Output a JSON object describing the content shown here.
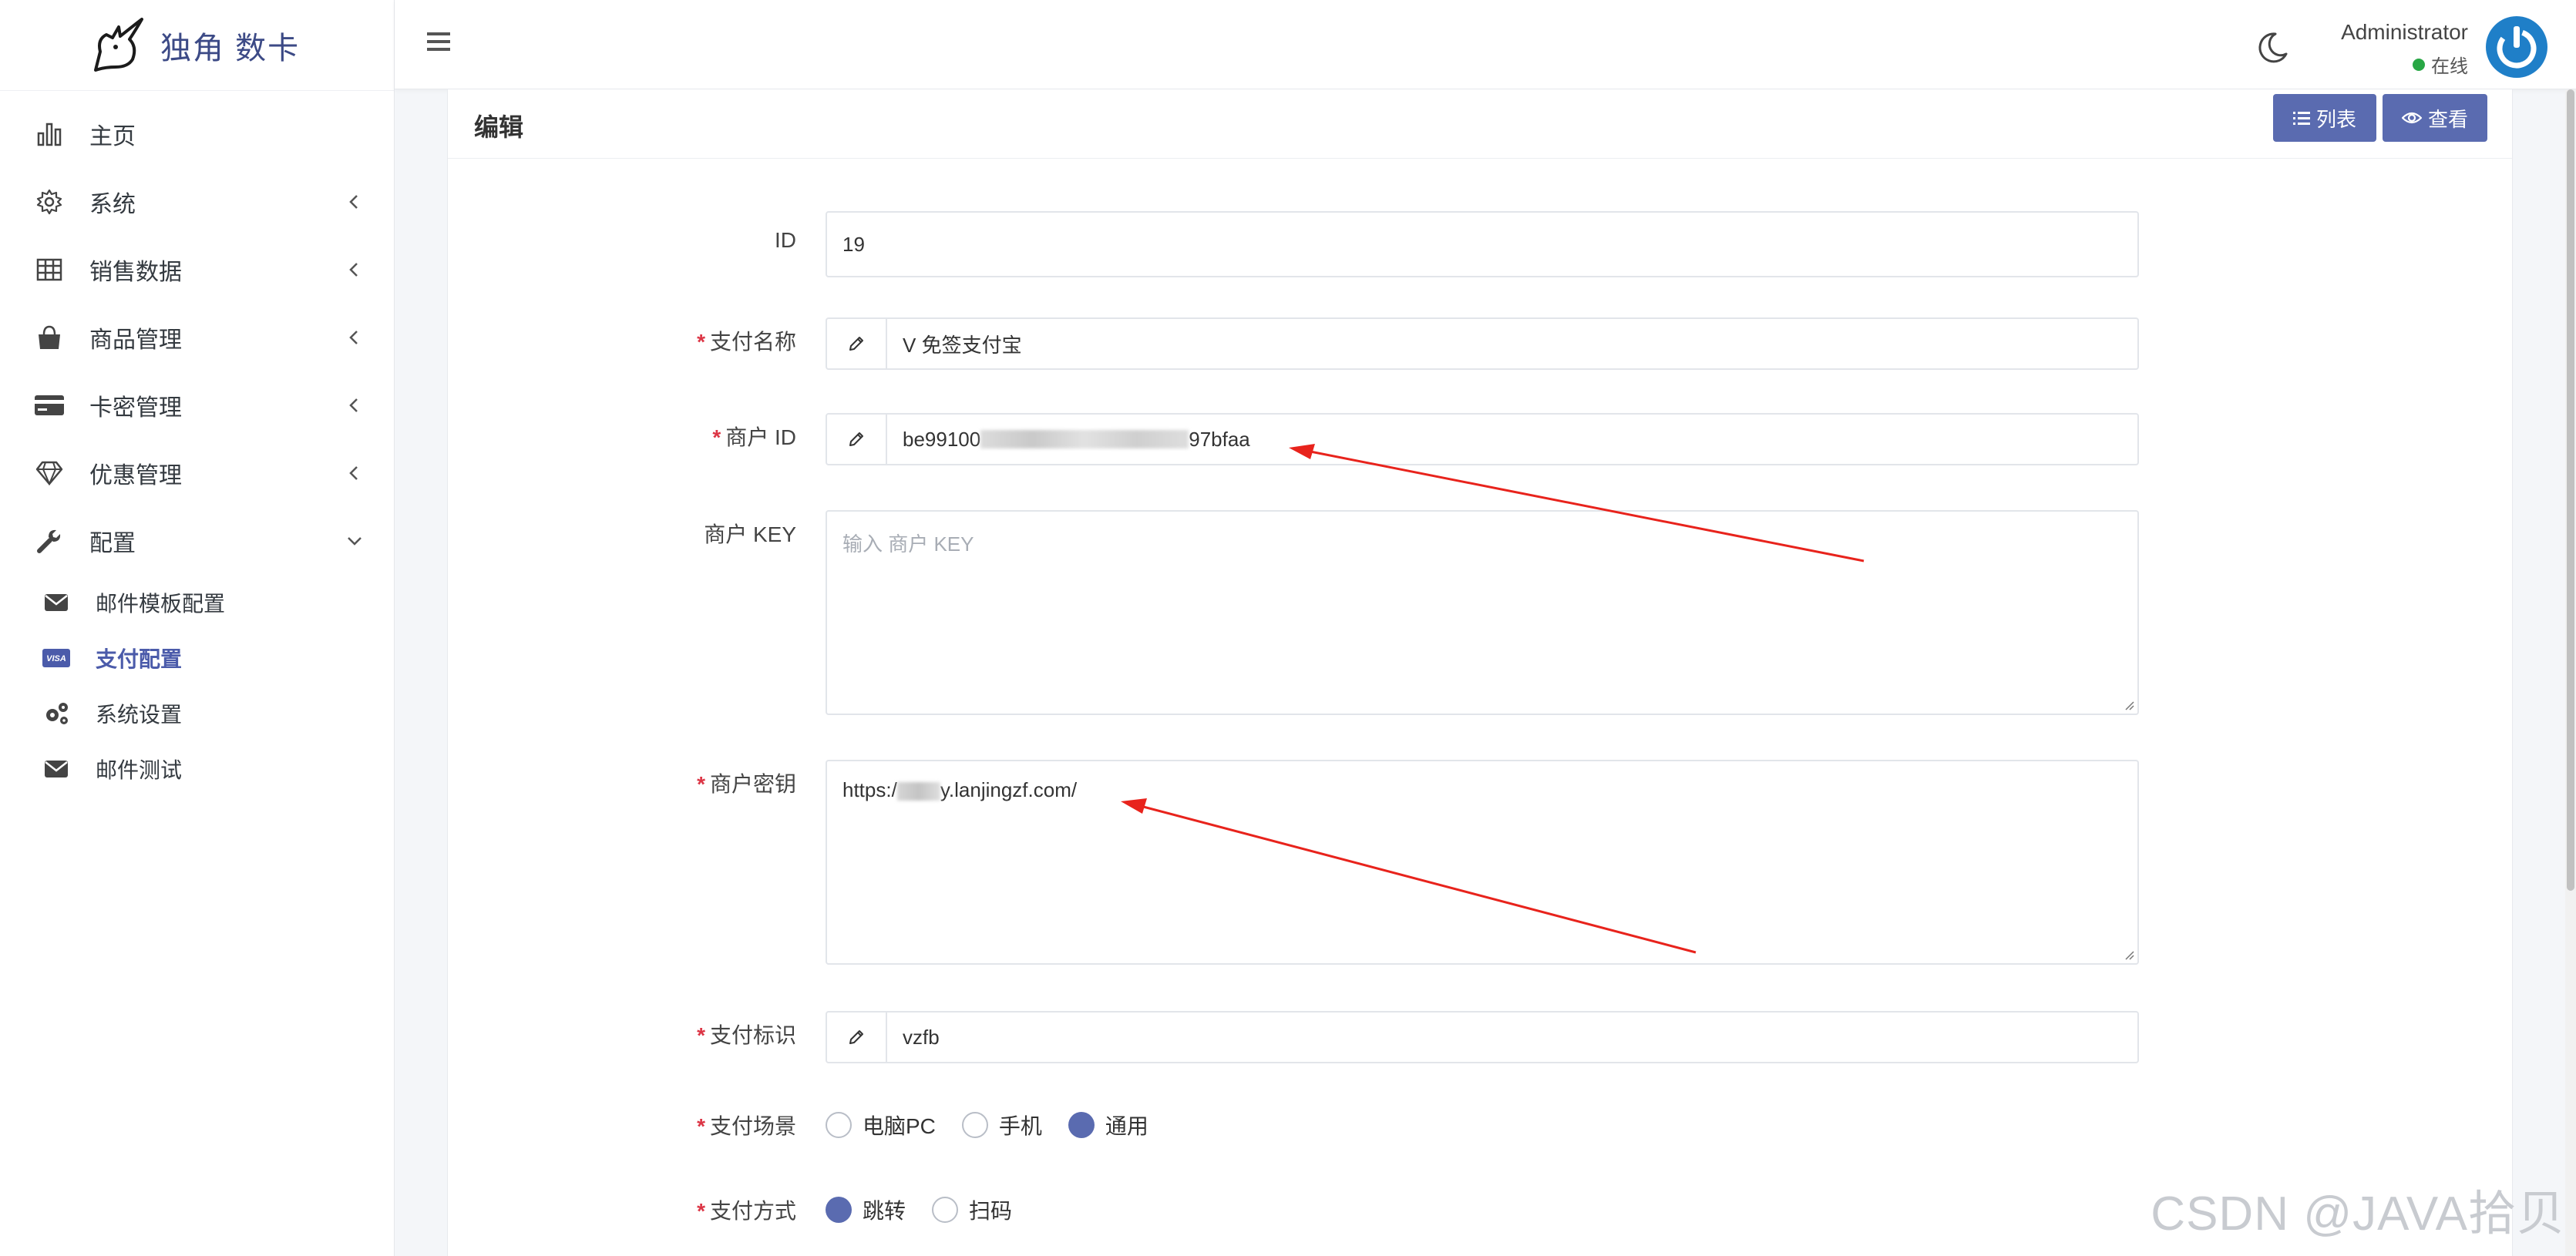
{
  "brand": {
    "name": "独角 数卡"
  },
  "sidebar": {
    "items": [
      {
        "label": "主页",
        "icon": "bar-chart-icon"
      },
      {
        "label": "系统",
        "icon": "gear-icon"
      },
      {
        "label": "销售数据",
        "icon": "table-icon"
      },
      {
        "label": "商品管理",
        "icon": "shopping-bag-icon"
      },
      {
        "label": "卡密管理",
        "icon": "credit-card-icon"
      },
      {
        "label": "优惠管理",
        "icon": "diamond-icon"
      },
      {
        "label": "配置",
        "icon": "wrench-icon"
      }
    ],
    "sub_items": [
      {
        "label": "邮件模板配置",
        "icon": "envelope-icon"
      },
      {
        "label": "支付配置",
        "icon": "visa-card-icon",
        "active": true
      },
      {
        "label": "系统设置",
        "icon": "gears-icon"
      },
      {
        "label": "邮件测试",
        "icon": "envelope-icon"
      }
    ]
  },
  "topbar": {
    "user_name": "Administrator",
    "user_status": "在线"
  },
  "card": {
    "title": "编辑",
    "btn_list": "列表",
    "btn_view": "查看"
  },
  "form": {
    "id": {
      "label": "ID",
      "value": "19"
    },
    "pay_name": {
      "label": "支付名称",
      "value": "V 免签支付宝"
    },
    "merchant_id": {
      "label": "商户 ID",
      "value_start": "be99100",
      "value_end": "97bfaa"
    },
    "merchant_key": {
      "label": "商户 KEY",
      "placeholder": "输入 商户 KEY"
    },
    "merchant_secret": {
      "label": "商户密钥",
      "value_start": "https:/",
      "value_end": "y.lanjingzf.com/"
    },
    "pay_check": {
      "label": "支付标识",
      "value": "vzfb"
    },
    "pay_client": {
      "label": "支付场景",
      "options": [
        "电脑PC",
        "手机",
        "通用"
      ],
      "selected": 2
    },
    "pay_method": {
      "label": "支付方式",
      "options": [
        "跳转",
        "扫码"
      ],
      "selected": 0
    }
  },
  "colors": {
    "accent": "#5a6bb0",
    "brand": "#3c4a86",
    "annotation_arrow": "#e8231c",
    "online": "#28a745",
    "required": "#dc3545"
  },
  "watermark": "CSDN @JAVA拾贝"
}
